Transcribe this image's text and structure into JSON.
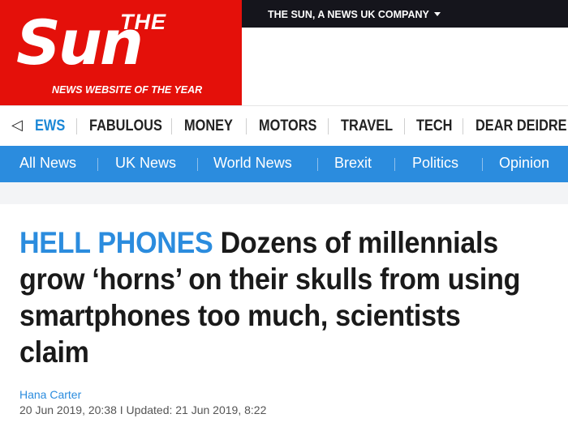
{
  "brand": {
    "the_text": "THE",
    "name_text": "Sun",
    "tagline": "NEWS WEBSITE OF THE YEAR",
    "color": "#e4100a"
  },
  "topbar": {
    "company_text": "THE SUN, A NEWS UK COMPANY",
    "icon": "chevron-down-icon"
  },
  "section_nav": {
    "back_icon": "chevron-left-icon",
    "items": [
      {
        "label": "EWS"
      },
      {
        "label": "FABULOUS"
      },
      {
        "label": "MONEY"
      },
      {
        "label": "MOTORS"
      },
      {
        "label": "TRAVEL"
      },
      {
        "label": "TECH"
      },
      {
        "label": "DEAR DEIDRE"
      }
    ],
    "active_color": "#1a87d6"
  },
  "sub_nav": {
    "items": [
      {
        "label": "All News"
      },
      {
        "label": "UK News"
      },
      {
        "label": "World News"
      },
      {
        "label": "Brexit"
      },
      {
        "label": "Politics"
      },
      {
        "label": "Opinion"
      }
    ],
    "color": "#2b8cde"
  },
  "article": {
    "kicker": "HELL PHONES",
    "headline": "Dozens of millennials grow ‘horns’ on their skulls from using smartphones too much, scientists claim",
    "author": "Hana Carter",
    "dateline": "20 Jun 2019, 20:38 I Updated: 21 Jun 2019, 8:22"
  }
}
